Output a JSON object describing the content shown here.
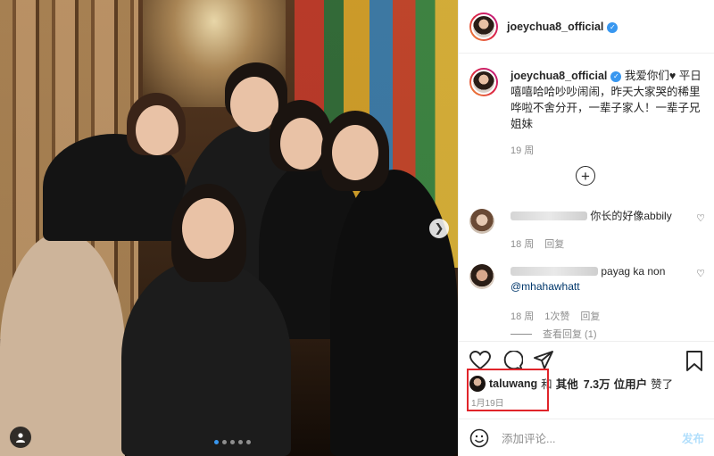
{
  "post": {
    "username": "joeychua8_official",
    "verified": true
  },
  "caption": {
    "username": "joeychua8_official",
    "text": "我爱你们♥ 平日嘻嘻哈哈吵吵闹闹，昨天大家哭的稀里哗啦不舍分开，一辈子家人！一辈子兄姐妹",
    "time": "19 周"
  },
  "comments": [
    {
      "text": "你长的好像abbily",
      "time": "18 周",
      "reply_label": "回复"
    },
    {
      "text": "payag ka non",
      "mention": "@mhahawhatt",
      "time": "18 周",
      "likes": "1次赞",
      "reply_label": "回复"
    }
  ],
  "view_replies": "查看回复 (1)",
  "likes": {
    "user": "taluwang",
    "connector": "和",
    "others_label": "其他",
    "count": "7.3万",
    "users_suffix": "位用户",
    "action": "赞了"
  },
  "date": "1月19日",
  "add_comment": {
    "placeholder": "添加评论...",
    "post_label": "发布"
  },
  "icons": {
    "like": "heart-icon",
    "comment": "comment-bubble-icon",
    "share": "paper-plane-icon",
    "save": "bookmark-icon",
    "emoji": "smiley-icon",
    "load_more": "plus-circle-icon",
    "next": "chevron-right-icon",
    "tag": "user-tag-icon"
  },
  "colors": {
    "link": "#00376b",
    "verified": "#3897f0",
    "highlight_box": "#e0242a",
    "post_button": "#b2dffc"
  },
  "carousel": {
    "current": 1,
    "total": 5
  }
}
